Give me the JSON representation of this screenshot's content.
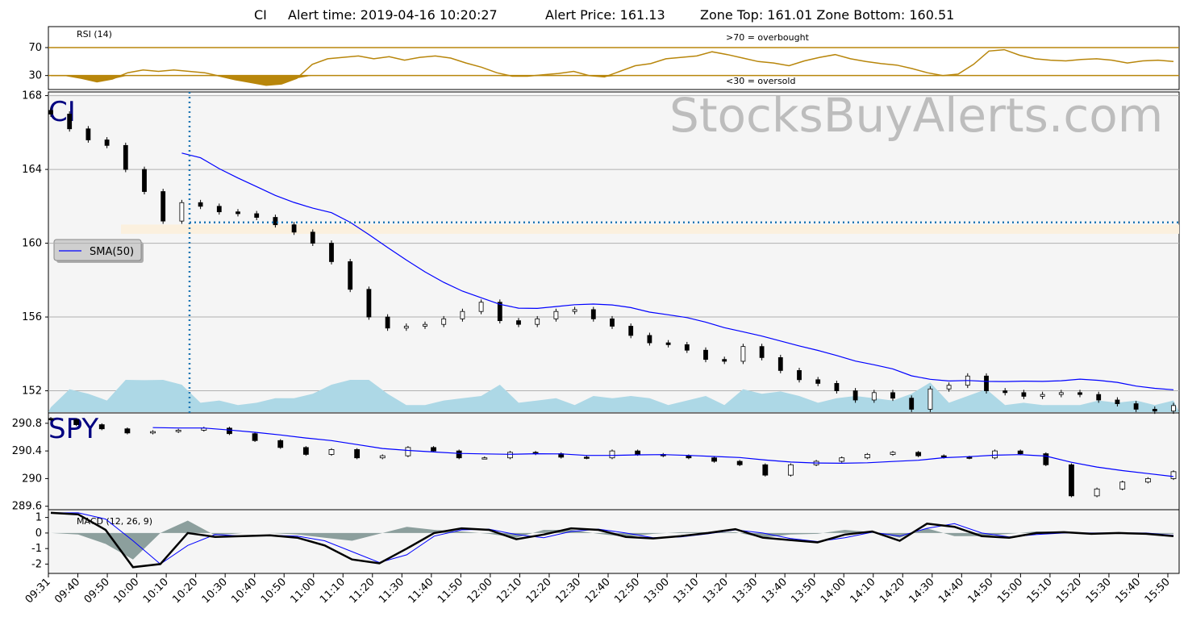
{
  "header": {
    "symbol": "CI",
    "alert_time": "Alert time: 2019-04-16 10:20:27",
    "alert_price": "Alert Price: 161.13",
    "zone": "Zone Top: 161.01  Zone Bottom: 160.51"
  },
  "watermark": "StocksBuyAlerts.com",
  "colors": {
    "rsi_line": "#b8860b",
    "sma_line": "#0000ff",
    "volume": "#add8e6",
    "zone": "#fbf0de",
    "alert_line": "#1f77b4",
    "macd_fill": "#5f7a78",
    "panel_bg": "#f5f5f5",
    "ticker_label": "#000080"
  },
  "chart_data": [
    {
      "id": "rsi",
      "type": "line",
      "title": "RSI (14)",
      "y_ticks": [
        30,
        70
      ],
      "ylim": [
        10,
        100
      ],
      "annotations": [
        ">70 = overbought",
        "<30 = oversold"
      ],
      "thresholds": [
        30,
        70
      ],
      "values": [
        30,
        30,
        26,
        21,
        25,
        34,
        38,
        36,
        38,
        36,
        34,
        29,
        24,
        20,
        16,
        18,
        26,
        46,
        54,
        56,
        58,
        54,
        57,
        52,
        56,
        58,
        55,
        48,
        42,
        34,
        29,
        29,
        31,
        33,
        36,
        30,
        28,
        36,
        44,
        47,
        54,
        56,
        58,
        64,
        60,
        55,
        50,
        48,
        44,
        51,
        56,
        60,
        54,
        50,
        47,
        45,
        40,
        34,
        30,
        32,
        46,
        65,
        67,
        59,
        54,
        52,
        51,
        53,
        54,
        52,
        48,
        51,
        52,
        50
      ]
    },
    {
      "id": "ci-price",
      "type": "candlestick",
      "ticker": "CI",
      "y_ticks": [
        152,
        156,
        160,
        164,
        168
      ],
      "ylim": [
        150.8,
        168.2
      ],
      "legend": "SMA(50)",
      "legend_position": "upper-left",
      "alert_price": 161.13,
      "alert_time": "10:20",
      "zone_top": 161.01,
      "zone_bottom": 160.51,
      "close": [
        167.0,
        166.2,
        165.6,
        165.3,
        164.0,
        162.8,
        161.2,
        162.2,
        162.0,
        161.7,
        161.6,
        161.4,
        161.0,
        160.6,
        160.0,
        159.0,
        157.5,
        156.0,
        155.4,
        155.5,
        155.6,
        155.9,
        156.3,
        156.8,
        155.8,
        155.6,
        155.9,
        156.3,
        156.4,
        155.9,
        155.5,
        155.0,
        154.6,
        154.5,
        154.2,
        153.7,
        153.6,
        154.4,
        153.8,
        153.1,
        152.6,
        152.4,
        152.0,
        151.5,
        151.9,
        151.6,
        151.0,
        152.1,
        152.3,
        152.8,
        152.0,
        151.9,
        151.7,
        151.8,
        151.9,
        151.8,
        151.5,
        151.3,
        151.0,
        150.9,
        151.2
      ]
    },
    {
      "id": "spy-price",
      "type": "candlestick",
      "ticker": "SPY",
      "y_ticks": [
        289.6,
        290.0,
        290.4,
        290.8
      ],
      "ylim": [
        289.55,
        290.95
      ],
      "close": [
        290.85,
        290.78,
        290.72,
        290.66,
        290.68,
        290.7,
        290.73,
        290.65,
        290.55,
        290.45,
        290.35,
        290.42,
        290.3,
        290.33,
        290.45,
        290.4,
        290.3,
        290.3,
        290.38,
        290.36,
        290.31,
        290.3,
        290.4,
        290.35,
        290.33,
        290.3,
        290.25,
        290.2,
        290.05,
        290.2,
        290.25,
        290.3,
        290.35,
        290.38,
        290.33,
        290.31,
        290.3,
        290.4,
        290.36,
        290.2,
        289.75,
        289.85,
        289.95,
        290.0,
        290.1
      ]
    },
    {
      "id": "macd",
      "type": "line",
      "title": "MACD (12, 26, 9)",
      "y_ticks": [
        -2,
        -1,
        0,
        1
      ],
      "ylim": [
        -2.6,
        1.5
      ],
      "macd": [
        1.3,
        1.2,
        0.2,
        -2.2,
        -2.0,
        0.0,
        -0.25,
        -0.2,
        -0.15,
        -0.3,
        -0.8,
        -1.7,
        -1.95,
        -1.0,
        0.0,
        0.3,
        0.2,
        -0.4,
        -0.1,
        0.3,
        0.2,
        -0.25,
        -0.35,
        -0.2,
        0.0,
        0.25,
        -0.3,
        -0.45,
        -0.6,
        -0.1,
        0.1,
        -0.5,
        0.6,
        0.4,
        -0.2,
        -0.3,
        0.0,
        0.05,
        -0.05,
        0.0,
        -0.05,
        -0.2
      ],
      "signal": [
        1.3,
        1.3,
        0.9,
        -0.5,
        -2.0,
        -0.8,
        -0.1,
        -0.2,
        -0.15,
        -0.2,
        -0.5,
        -1.2,
        -1.9,
        -1.4,
        -0.2,
        0.2,
        0.25,
        -0.1,
        -0.3,
        0.1,
        0.25,
        0.0,
        -0.3,
        -0.25,
        -0.05,
        0.2,
        0.0,
        -0.35,
        -0.55,
        -0.3,
        0.05,
        -0.2,
        0.3,
        0.6,
        0.0,
        -0.25,
        -0.1,
        0.0,
        0.0,
        0.0,
        0.0,
        -0.15
      ]
    }
  ],
  "x_axis": {
    "tick_labels": [
      "09:31",
      "09:40",
      "09:50",
      "10:00",
      "10:10",
      "10:20",
      "10:30",
      "10:40",
      "10:50",
      "11:00",
      "11:10",
      "11:20",
      "11:30",
      "11:40",
      "11:50",
      "12:00",
      "12:10",
      "12:20",
      "12:30",
      "12:40",
      "12:50",
      "13:00",
      "13:10",
      "13:20",
      "13:30",
      "13:40",
      "13:50",
      "14:00",
      "14:10",
      "14:20",
      "14:30",
      "14:40",
      "14:50",
      "15:00",
      "15:10",
      "15:20",
      "15:30",
      "15:40",
      "15:50"
    ]
  }
}
